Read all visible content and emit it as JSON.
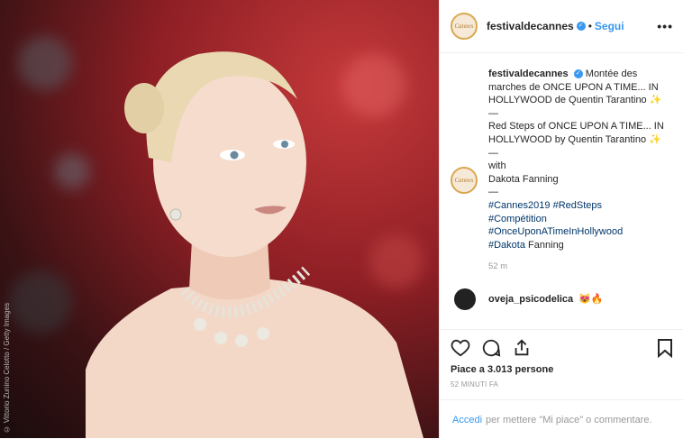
{
  "photo": {
    "alt": "photo",
    "credit": "© Vittorio Zunino Celotto / Getty Images"
  },
  "header": {
    "username": "festivaldecannes",
    "avatar_text": "Cannes",
    "dot": "•",
    "follow_label": "Segui",
    "more_label": "•••"
  },
  "caption": {
    "username": "festivaldecannes",
    "lines": [
      "Montée des marches de ONCE UPON A TIME... IN HOLLYWOOD de Quentin Tarantino ✨",
      "—",
      "Red Steps of ONCE UPON A TIME... IN HOLLYWOOD by Quentin Tarantino ✨",
      "—",
      "with",
      "Dakota Fanning",
      "—"
    ],
    "hashtags": [
      "#Cannes2019",
      "#RedSteps",
      "#Compétition",
      "#OnceUponATimeInHollywood",
      "#Dakota"
    ],
    "after_tag": "Fanning",
    "time": "52 m"
  },
  "reply": {
    "username": "oveja_psicodelica",
    "text": "😻🔥"
  },
  "actions": {
    "likes": "Piace a 3.013 persone",
    "ago": "52 MINUTI FA"
  },
  "login": {
    "link": "Accedi",
    "text": "per mettere \"Mi piace\" o commentare."
  },
  "colors": {
    "accent": "#3897f0",
    "hashtag": "#003569"
  }
}
